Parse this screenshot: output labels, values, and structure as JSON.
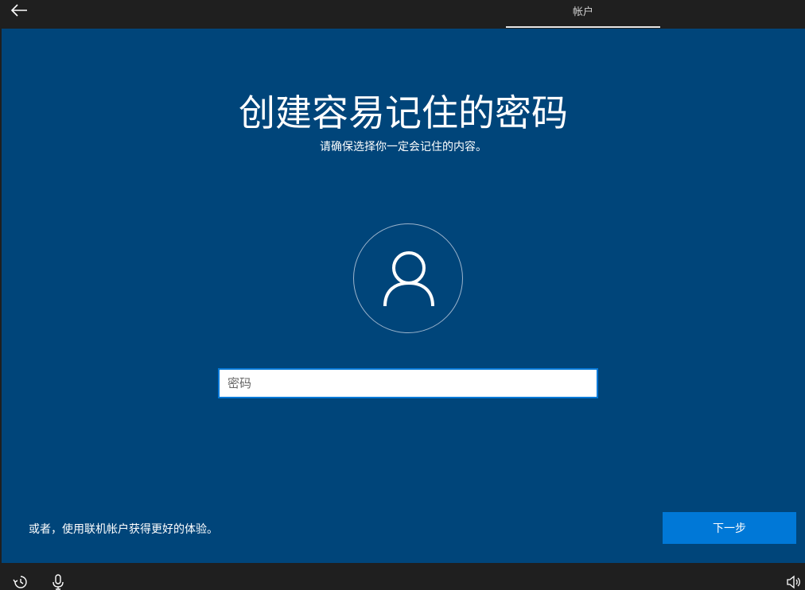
{
  "header": {
    "back_icon": "back-arrow-icon",
    "tab_label": "帐户"
  },
  "main": {
    "title": "创建容易记住的密码",
    "subtitle": "请确保选择你一定会记住的内容。",
    "avatar_icon": "user-icon",
    "password_placeholder": "密码",
    "online_account_link": "或者，使用联机帐户获得更好的体验。",
    "next_button": "下一步"
  },
  "footer": {
    "icons": [
      "ease-of-access-icon",
      "microphone-icon",
      "volume-icon"
    ]
  },
  "colors": {
    "background": "#00457a",
    "accent": "#0078d7",
    "chrome": "#1f1f1f"
  }
}
